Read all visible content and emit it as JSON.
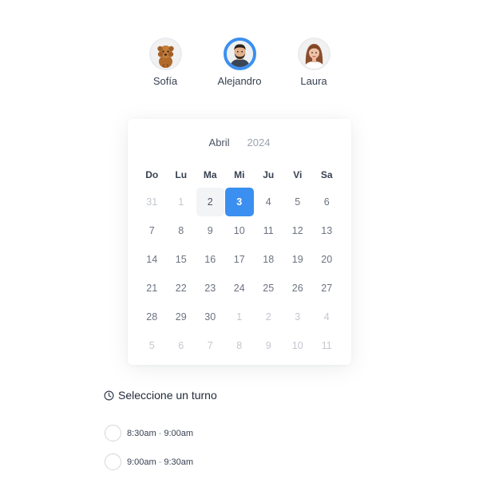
{
  "staff": [
    {
      "name": "Sofía",
      "avatar": "dog-avatar",
      "selected": false
    },
    {
      "name": "Alejandro",
      "avatar": "man-avatar",
      "selected": true
    },
    {
      "name": "Laura",
      "avatar": "woman-avatar",
      "selected": false
    }
  ],
  "calendar": {
    "month": "Abril",
    "year": "2024",
    "weekdays": [
      "Do",
      "Lu",
      "Ma",
      "Mi",
      "Ju",
      "Vi",
      "Sa"
    ],
    "days": [
      {
        "label": "31",
        "muted": true
      },
      {
        "label": "1",
        "muted": true
      },
      {
        "label": "2",
        "today": true
      },
      {
        "label": "3",
        "selected": true
      },
      {
        "label": "4"
      },
      {
        "label": "5"
      },
      {
        "label": "6"
      },
      {
        "label": "7"
      },
      {
        "label": "8"
      },
      {
        "label": "9"
      },
      {
        "label": "10"
      },
      {
        "label": "11"
      },
      {
        "label": "12"
      },
      {
        "label": "13"
      },
      {
        "label": "14"
      },
      {
        "label": "15"
      },
      {
        "label": "16"
      },
      {
        "label": "17"
      },
      {
        "label": "18"
      },
      {
        "label": "19"
      },
      {
        "label": "20"
      },
      {
        "label": "21"
      },
      {
        "label": "22"
      },
      {
        "label": "23"
      },
      {
        "label": "24"
      },
      {
        "label": "25"
      },
      {
        "label": "26"
      },
      {
        "label": "27"
      },
      {
        "label": "28"
      },
      {
        "label": "29"
      },
      {
        "label": "30"
      },
      {
        "label": "1",
        "muted": true
      },
      {
        "label": "2",
        "muted": true
      },
      {
        "label": "3",
        "muted": true
      },
      {
        "label": "4",
        "muted": true
      },
      {
        "label": "5",
        "muted": true
      },
      {
        "label": "6",
        "muted": true
      },
      {
        "label": "7",
        "muted": true
      },
      {
        "label": "8",
        "muted": true
      },
      {
        "label": "9",
        "muted": true
      },
      {
        "label": "10",
        "muted": true
      },
      {
        "label": "11",
        "muted": true
      }
    ]
  },
  "shifts": {
    "title": "Seleccione un turno",
    "icon": "clock-icon",
    "slots": [
      {
        "start": "8:30am",
        "separator": "-",
        "end": "9:00am"
      },
      {
        "start": "9:00am",
        "separator": "-",
        "end": "9:30am"
      }
    ]
  },
  "colors": {
    "accent": "#3b8ff0",
    "today_bg": "#f3f4f6"
  }
}
